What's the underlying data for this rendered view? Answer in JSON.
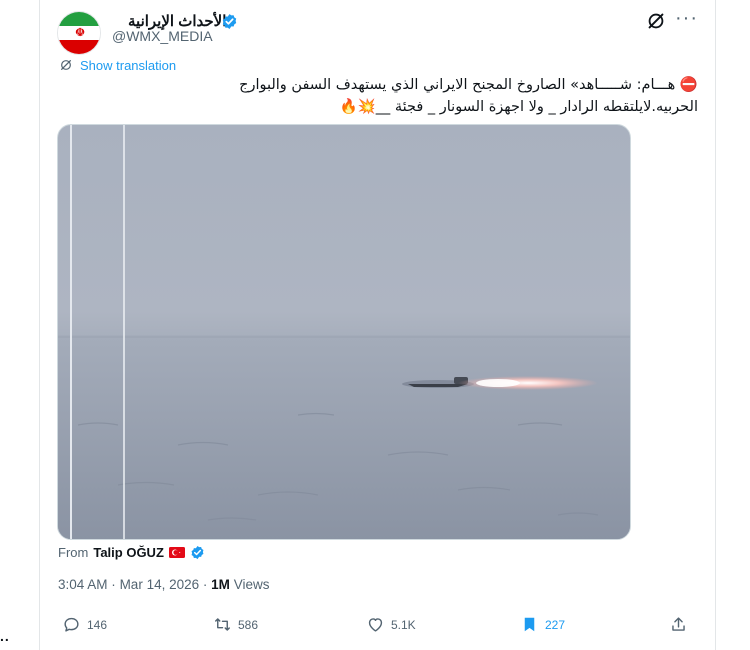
{
  "account": {
    "display_name": "الأحداث الإيرانية",
    "handle": "@WMX_MEDIA",
    "verified": true
  },
  "translate": {
    "label": "Show translation"
  },
  "tweet": {
    "line1": "⛔ هـــام: شـــــاهد» الصاروخ المجنح الايراني الذي يستهدف السفن والبوارج",
    "line2": "الحربيه.لايلتقطه الرادار _ ولا اجهزة السونار _ فجئة __💥🔥"
  },
  "attribution": {
    "prefix": "From",
    "author": "Talip OĞUZ",
    "flag_icon": "turkey-flag-icon",
    "verified": true
  },
  "meta": {
    "time": "3:04 AM",
    "separator": "·",
    "date": "Mar 14, 2026",
    "views_count": "1M",
    "views_label": "Views"
  },
  "actions": {
    "replies": "146",
    "reposts": "586",
    "likes": "5.1K",
    "bookmarks": "227"
  },
  "side": {
    "dots": ".."
  },
  "colors": {
    "accent": "#1d9bf0",
    "muted": "#536471",
    "text": "#0f1419"
  }
}
